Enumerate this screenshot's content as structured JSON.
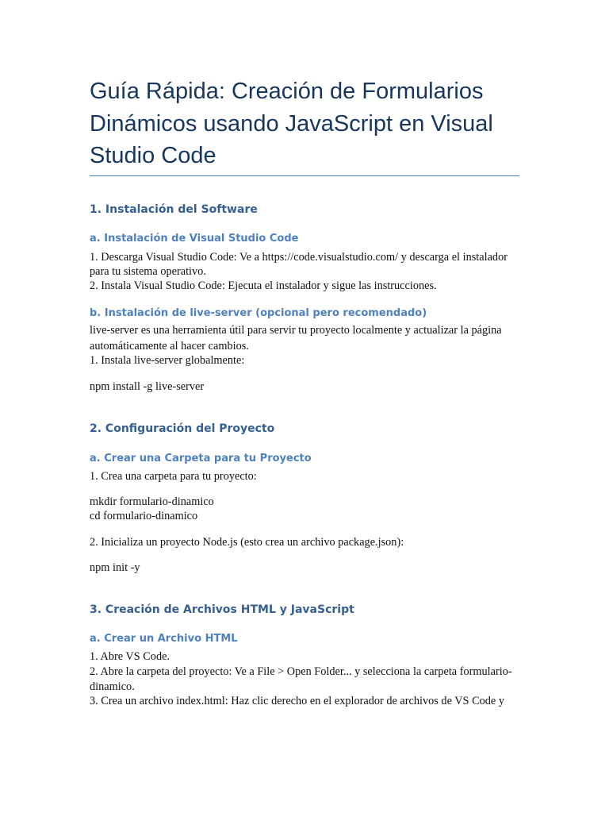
{
  "title_lines": [
    "Guía Rápida: Creación de Formularios",
    "Dinámicos usando JavaScript en Visual",
    "Studio Code"
  ],
  "s1": {
    "heading": "1. Instalación del Software",
    "a": {
      "heading": "a. Instalación de Visual Studio Code",
      "lines": [
        "1. Descarga Visual Studio Code: Ve a https://code.visualstudio.com/ y descarga el instalador",
        "para tu sistema operativo.",
        "2. Instala Visual Studio Code: Ejecuta el instalador y sigue las instrucciones."
      ]
    },
    "b": {
      "heading": "b. Instalación de live-server (opcional pero recomendado)",
      "lines": [
        "live-server es una herramienta útil para servir tu proyecto localmente y actualizar la página",
        "automáticamente al hacer cambios.",
        "1. Instala live-server globalmente:"
      ],
      "code": "npm install -g live-server"
    }
  },
  "s2": {
    "heading": "2. Configuración del Proyecto",
    "a": {
      "heading": "a. Crear una Carpeta para tu Proyecto",
      "step1": "1. Crea una carpeta para tu proyecto:",
      "code1": [
        "mkdir formulario-dinamico",
        "cd formulario-dinamico"
      ],
      "step2": "2. Inicializa un proyecto Node.js (esto crea un archivo package.json):",
      "code2": "npm init -y"
    }
  },
  "s3": {
    "heading": "3. Creación de Archivos HTML y JavaScript",
    "a": {
      "heading": "a. Crear un Archivo HTML",
      "lines": [
        "1. Abre VS Code.",
        "2. Abre la carpeta del proyecto: Ve a File > Open Folder... y selecciona la carpeta formulario-",
        "dinamico.",
        "3. Crea un archivo index.html: Haz clic derecho en el explorador de archivos de VS Code y"
      ]
    }
  }
}
